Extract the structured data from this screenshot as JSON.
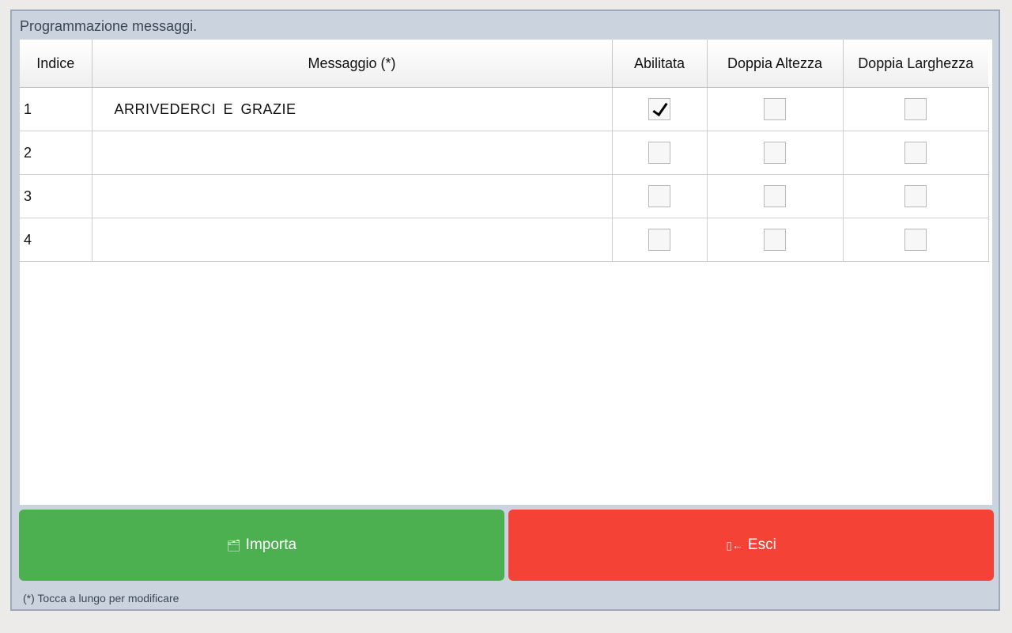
{
  "dialog": {
    "title": "Programmazione messaggi.",
    "footer_note": "(*) Tocca a lungo per modificare"
  },
  "table": {
    "columns": [
      "Indice",
      "Messaggio (*)",
      "Abilitata",
      "Doppia Altezza",
      "Doppia Larghezza"
    ],
    "rows": [
      {
        "index": "1",
        "message": "ARRIVEDERCI  E  GRAZIE",
        "enabled": true,
        "double_height": false,
        "double_width": false
      },
      {
        "index": "2",
        "message": "",
        "enabled": false,
        "double_height": false,
        "double_width": false
      },
      {
        "index": "3",
        "message": "",
        "enabled": false,
        "double_height": false,
        "double_width": false
      },
      {
        "index": "4",
        "message": "",
        "enabled": false,
        "double_height": false,
        "double_width": false
      }
    ]
  },
  "buttons": {
    "import_label": "Importa",
    "import_icon": "folder-import-icon",
    "exit_label": "Esci",
    "exit_icon": "exit-door-icon",
    "import_color": "#4caf50",
    "exit_color": "#f44336"
  }
}
